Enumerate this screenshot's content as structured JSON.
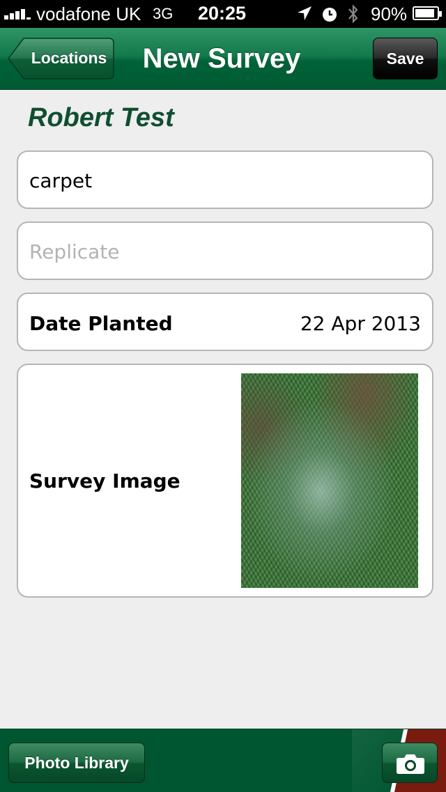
{
  "status_bar": {
    "carrier": "vodafone UK",
    "network": "3G",
    "time": "20:25",
    "battery_percent": "90%",
    "battery_level": 0.9
  },
  "nav": {
    "back_label": "Locations",
    "title": "New Survey",
    "save_label": "Save"
  },
  "form": {
    "person_name": "Robert Test",
    "name_field": {
      "value": "carpet"
    },
    "replicate_field": {
      "value": "",
      "placeholder": "Replicate"
    },
    "date_planted": {
      "label": "Date Planted",
      "value": "22 Apr 2013"
    },
    "survey_image": {
      "label": "Survey Image"
    }
  },
  "toolbar": {
    "photo_library_label": "Photo Library",
    "camera_icon": "camera-icon"
  },
  "colors": {
    "nav_green": "#006238",
    "title_green": "#0f4f2f",
    "toolbar_green": "#005631",
    "accent_red": "#7a1b10"
  }
}
